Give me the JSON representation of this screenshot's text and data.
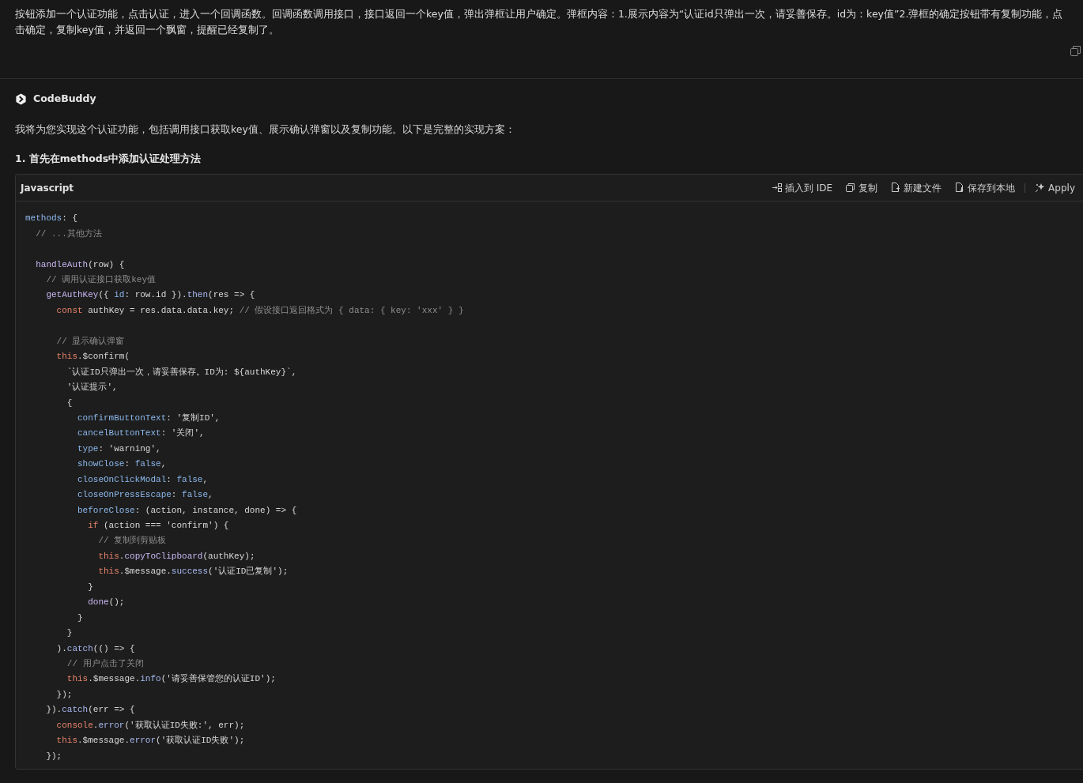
{
  "user_message": {
    "text": "按钮添加一个认证功能，点击认证，进入一个回调函数。回调函数调用接口，接口返回一个key值，弹出弹框让用户确定。弹框内容：1.展示内容为“认证id只弹出一次，请妥善保存。id为：key值”2.弹框的确定按钮带有复制功能，点击确定，复制key值，并返回一个飘窗，提醒已经复制了。"
  },
  "assistant": {
    "name": "CodeBuddy",
    "intro": "我将为您实现这个认证功能，包括调用接口获取key值、展示确认弹窗以及复制功能。以下是完整的实现方案：",
    "heading": "1. 首先在methods中添加认证处理方法",
    "code_block": {
      "language": "Javascript",
      "actions": [
        {
          "kind": "insert",
          "label": "插入到 IDE"
        },
        {
          "kind": "copy",
          "label": "复制"
        },
        {
          "kind": "new-file",
          "label": "新建文件"
        },
        {
          "kind": "save",
          "label": "保存到本地"
        },
        {
          "kind": "apply",
          "label": "Apply"
        }
      ],
      "lines": [
        {
          "kind": "code",
          "segments": [
            {
              "kind": "key",
              "text": "methods"
            },
            {
              "kind": "plain",
              "text": ": {"
            }
          ]
        },
        {
          "kind": "code",
          "segments": [
            {
              "kind": "comment",
              "text": "  // ...其他方法"
            }
          ]
        },
        {
          "kind": "blank"
        },
        {
          "kind": "code",
          "segments": [
            {
              "kind": "fn",
              "text": "  handleAuth"
            },
            {
              "kind": "plain",
              "text": "(row) {"
            }
          ]
        },
        {
          "kind": "code",
          "segments": [
            {
              "kind": "comment",
              "text": "    // 调用认证接口获取key值"
            }
          ]
        },
        {
          "kind": "code",
          "segments": [
            {
              "kind": "fn",
              "text": "    getAuthKey"
            },
            {
              "kind": "plain",
              "text": "({ "
            },
            {
              "kind": "key",
              "text": "id"
            },
            {
              "kind": "plain",
              "text": ": row.id })."
            },
            {
              "kind": "method",
              "text": "then"
            },
            {
              "kind": "plain",
              "text": "(res => {"
            }
          ]
        },
        {
          "kind": "code",
          "segments": [
            {
              "kind": "keyword",
              "text": "      const"
            },
            {
              "kind": "plain",
              "text": " authKey = res.data.data.key; "
            },
            {
              "kind": "comment",
              "text": "// 假设接口返回格式为 { data: { key: 'xxx' } }"
            }
          ]
        },
        {
          "kind": "blank"
        },
        {
          "kind": "code",
          "segments": [
            {
              "kind": "comment",
              "text": "      // 显示确认弹窗"
            }
          ]
        },
        {
          "kind": "code",
          "segments": [
            {
              "kind": "keyword",
              "text": "      this"
            },
            {
              "kind": "plain",
              "text": ".$confirm("
            }
          ]
        },
        {
          "kind": "code",
          "segments": [
            {
              "kind": "plain",
              "text": "        `认证ID只弹出一次，请妥善保存。ID为: ${authKey}`,"
            }
          ]
        },
        {
          "kind": "code",
          "segments": [
            {
              "kind": "plain",
              "text": "        '认证提示',"
            }
          ]
        },
        {
          "kind": "code",
          "segments": [
            {
              "kind": "plain",
              "text": "        {"
            }
          ]
        },
        {
          "kind": "code",
          "segments": [
            {
              "kind": "key",
              "text": "          confirmButtonText"
            },
            {
              "kind": "plain",
              "text": ": '复制ID',"
            }
          ]
        },
        {
          "kind": "code",
          "segments": [
            {
              "kind": "key",
              "text": "          cancelButtonText"
            },
            {
              "kind": "plain",
              "text": ": '关闭',"
            }
          ]
        },
        {
          "kind": "code",
          "segments": [
            {
              "kind": "key",
              "text": "          type"
            },
            {
              "kind": "plain",
              "text": ": 'warning',"
            }
          ]
        },
        {
          "kind": "code",
          "segments": [
            {
              "kind": "key",
              "text": "          showClose"
            },
            {
              "kind": "plain",
              "text": ": "
            },
            {
              "kind": "key",
              "text": "false"
            },
            {
              "kind": "plain",
              "text": ","
            }
          ]
        },
        {
          "kind": "code",
          "segments": [
            {
              "kind": "key",
              "text": "          closeOnClickModal"
            },
            {
              "kind": "plain",
              "text": ": "
            },
            {
              "kind": "key",
              "text": "false"
            },
            {
              "kind": "plain",
              "text": ","
            }
          ]
        },
        {
          "kind": "code",
          "segments": [
            {
              "kind": "key",
              "text": "          closeOnPressEscape"
            },
            {
              "kind": "plain",
              "text": ": "
            },
            {
              "kind": "key",
              "text": "false"
            },
            {
              "kind": "plain",
              "text": ","
            }
          ]
        },
        {
          "kind": "code",
          "segments": [
            {
              "kind": "key",
              "text": "          beforeClose"
            },
            {
              "kind": "plain",
              "text": ": (action, instance, done) => {"
            }
          ]
        },
        {
          "kind": "code",
          "segments": [
            {
              "kind": "keyword",
              "text": "            if"
            },
            {
              "kind": "plain",
              "text": " (action === 'confirm') {"
            }
          ]
        },
        {
          "kind": "code",
          "segments": [
            {
              "kind": "comment",
              "text": "              // 复制到剪贴板"
            }
          ]
        },
        {
          "kind": "code",
          "segments": [
            {
              "kind": "keyword",
              "text": "              this"
            },
            {
              "kind": "plain",
              "text": "."
            },
            {
              "kind": "fn",
              "text": "copyToClipboard"
            },
            {
              "kind": "plain",
              "text": "(authKey);"
            }
          ]
        },
        {
          "kind": "code",
          "segments": [
            {
              "kind": "keyword",
              "text": "              this"
            },
            {
              "kind": "plain",
              "text": ".$message."
            },
            {
              "kind": "method",
              "text": "success"
            },
            {
              "kind": "plain",
              "text": "('认证ID已复制');"
            }
          ]
        },
        {
          "kind": "code",
          "segments": [
            {
              "kind": "plain",
              "text": "            }"
            }
          ]
        },
        {
          "kind": "code",
          "segments": [
            {
              "kind": "fn",
              "text": "            done"
            },
            {
              "kind": "plain",
              "text": "();"
            }
          ]
        },
        {
          "kind": "code",
          "segments": [
            {
              "kind": "plain",
              "text": "          }"
            }
          ]
        },
        {
          "kind": "code",
          "segments": [
            {
              "kind": "plain",
              "text": "        }"
            }
          ]
        },
        {
          "kind": "code",
          "segments": [
            {
              "kind": "plain",
              "text": "      )."
            },
            {
              "kind": "method",
              "text": "catch"
            },
            {
              "kind": "plain",
              "text": "(() => {"
            }
          ]
        },
        {
          "kind": "code",
          "segments": [
            {
              "kind": "comment",
              "text": "        // 用户点击了关闭"
            }
          ]
        },
        {
          "kind": "code",
          "segments": [
            {
              "kind": "keyword",
              "text": "        this"
            },
            {
              "kind": "plain",
              "text": ".$message."
            },
            {
              "kind": "method",
              "text": "info"
            },
            {
              "kind": "plain",
              "text": "('请妥善保管您的认证ID');"
            }
          ]
        },
        {
          "kind": "code",
          "segments": [
            {
              "kind": "plain",
              "text": "      });"
            }
          ]
        },
        {
          "kind": "code",
          "segments": [
            {
              "kind": "plain",
              "text": "    })."
            },
            {
              "kind": "method",
              "text": "catch"
            },
            {
              "kind": "plain",
              "text": "(err => {"
            }
          ]
        },
        {
          "kind": "code",
          "segments": [
            {
              "kind": "keyword",
              "text": "      console"
            },
            {
              "kind": "plain",
              "text": "."
            },
            {
              "kind": "method",
              "text": "error"
            },
            {
              "kind": "plain",
              "text": "('获取认证ID失败:', err);"
            }
          ]
        },
        {
          "kind": "code",
          "segments": [
            {
              "kind": "keyword",
              "text": "      this"
            },
            {
              "kind": "plain",
              "text": ".$message."
            },
            {
              "kind": "method",
              "text": "error"
            },
            {
              "kind": "plain",
              "text": "('获取认证ID失败');"
            }
          ]
        },
        {
          "kind": "code",
          "segments": [
            {
              "kind": "plain",
              "text": "    });"
            }
          ]
        }
      ]
    }
  }
}
